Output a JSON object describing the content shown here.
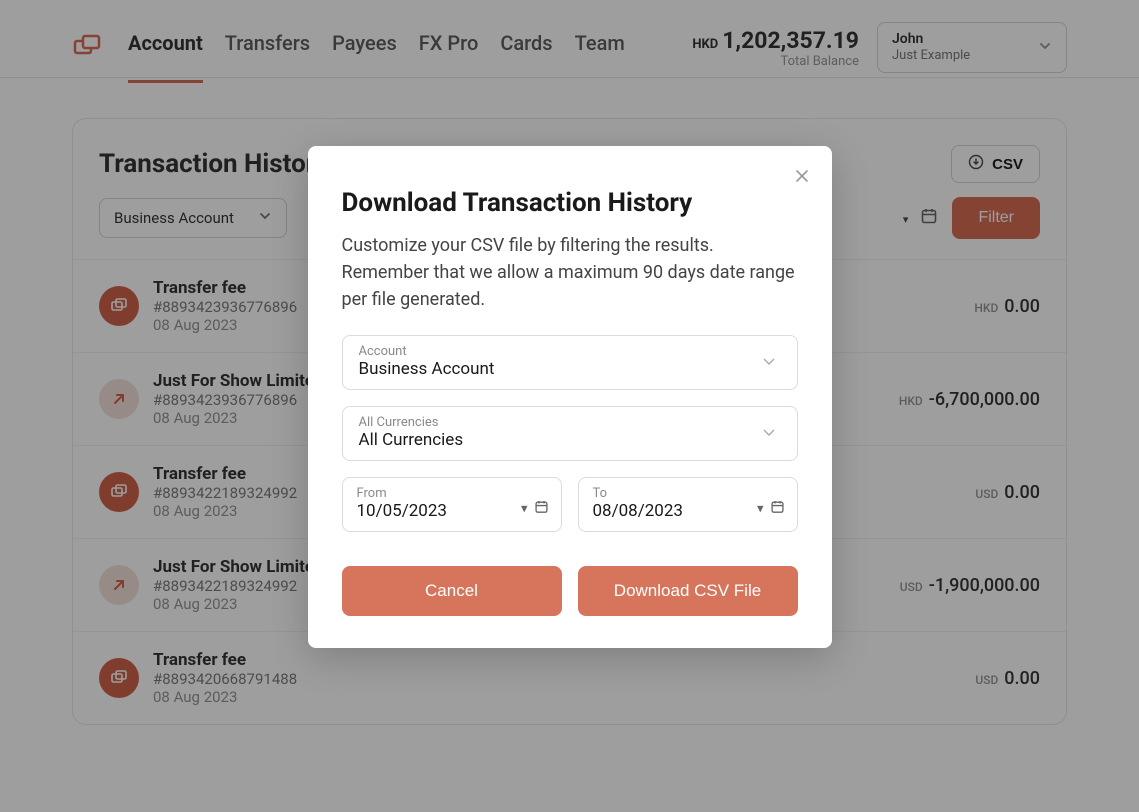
{
  "header": {
    "nav": [
      "Account",
      "Transfers",
      "Payees",
      "FX Pro",
      "Cards",
      "Team"
    ],
    "active_nav_index": 0,
    "balance_currency": "HKD",
    "balance_amount": "1,202,357.19",
    "balance_label": "Total Balance",
    "user_name": "John",
    "user_company": "Just Example"
  },
  "page": {
    "title": "Transaction History",
    "csv_button": "CSV",
    "account_filter": "Business Account",
    "filter_button": "Filter"
  },
  "transactions": [
    {
      "icon": "fee",
      "title": "Transfer fee",
      "ref": "#8893423936776896",
      "date": "08 Aug 2023",
      "ccy": "HKD",
      "amount": "0.00"
    },
    {
      "icon": "out",
      "title": "Just For Show Limited fo",
      "ref": "#8893423936776896",
      "date": "08 Aug 2023",
      "ccy": "HKD",
      "amount": "-6,700,000.00"
    },
    {
      "icon": "fee",
      "title": "Transfer fee",
      "ref": "#8893422189324992",
      "date": "08 Aug 2023",
      "ccy": "USD",
      "amount": "0.00"
    },
    {
      "icon": "out",
      "title": "Just For Show Limited fo",
      "ref": "#8893422189324992",
      "date": "08 Aug 2023",
      "ccy": "USD",
      "amount": "-1,900,000.00"
    },
    {
      "icon": "fee",
      "title": "Transfer fee",
      "ref": "#8893420668791488",
      "date": "08 Aug 2023",
      "ccy": "USD",
      "amount": "0.00"
    }
  ],
  "modal": {
    "title": "Download Transaction History",
    "description": "Customize your CSV file by filtering the results. Remember that we allow a maximum 90 days date range per file generated.",
    "account_label": "Account",
    "account_value": "Business Account",
    "currency_label": "All Currencies",
    "currency_value": "All Currencies",
    "from_label": "From",
    "from_value": "10/05/2023",
    "to_label": "To",
    "to_value": "08/08/2023",
    "cancel": "Cancel",
    "download": "Download CSV File"
  }
}
